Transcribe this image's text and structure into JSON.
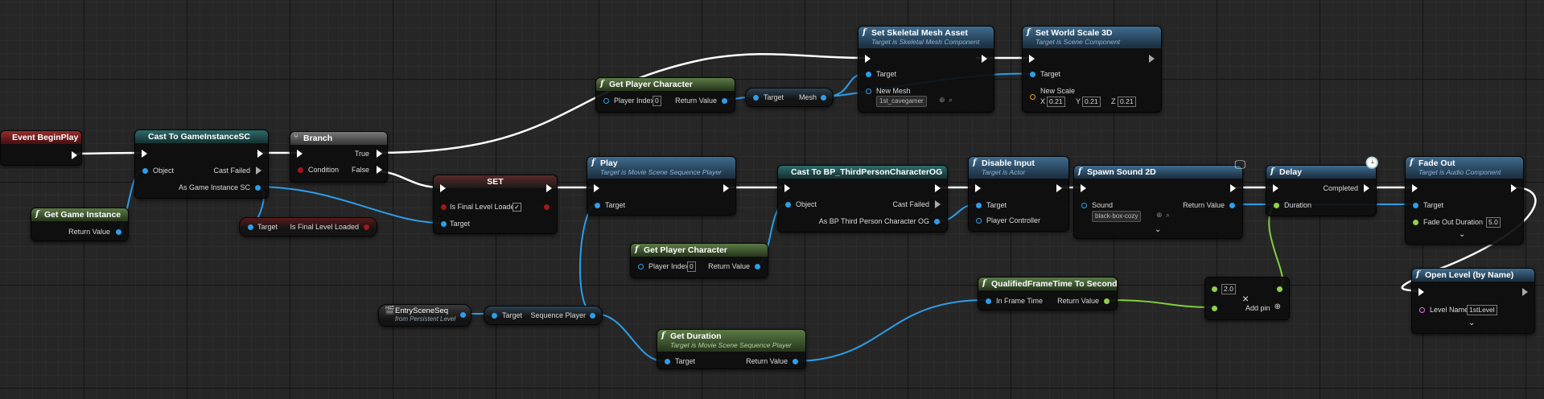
{
  "nodes": {
    "event_begin_play": {
      "title": "Event BeginPlay"
    },
    "get_game_instance": {
      "title": "Get Game Instance",
      "return_value": "Return Value"
    },
    "cast_gi": {
      "title": "Cast To GameInstanceSC",
      "object": "Object",
      "cast_failed": "Cast Failed",
      "as_gi": "As Game Instance SC"
    },
    "branch": {
      "title": "Branch",
      "condition": "Condition",
      "true": "True",
      "false": "False"
    },
    "is_final_get": {
      "target": "Target",
      "value": "Is Final Level Loaded"
    },
    "set_node": {
      "title": "SET",
      "var": "Is Final Level Loaded",
      "target": "Target",
      "checked": "✓"
    },
    "get_player_char_top": {
      "title": "Get Player Character",
      "player_index": "Player Index",
      "player_index_value": "0",
      "return_value": "Return Value"
    },
    "mesh_get": {
      "target": "Target",
      "mesh": "Mesh"
    },
    "set_skel": {
      "title": "Set Skeletal Mesh Asset",
      "subtitle": "Target is Skeletal Mesh Component",
      "target": "Target",
      "new_mesh": "New Mesh",
      "mesh_value": "1st_cavegamer"
    },
    "set_scale": {
      "title": "Set World Scale 3D",
      "subtitle": "Target is Scene Component",
      "target": "Target",
      "new_scale": "New Scale",
      "x_label": "X",
      "x": "0.21",
      "y_label": "Y",
      "y": "0.21",
      "z_label": "Z",
      "z": "0.21"
    },
    "play": {
      "title": "Play",
      "subtitle": "Target is Movie Scene Sequence Player",
      "target": "Target"
    },
    "cast_bp": {
      "title": "Cast To BP_ThirdPersonCharacterOG",
      "object": "Object",
      "cast_failed": "Cast Failed",
      "as_bp": "As BP Third Person Character OG"
    },
    "disable_input": {
      "title": "Disable Input",
      "subtitle": "Target is Actor",
      "target": "Target",
      "player_controller": "Player Controller"
    },
    "spawn_sound": {
      "title": "Spawn Sound 2D",
      "sound": "Sound",
      "sound_value": "black-box-cozy",
      "return_value": "Return Value"
    },
    "delay": {
      "title": "Delay",
      "completed": "Completed",
      "duration": "Duration"
    },
    "fade_out": {
      "title": "Fade Out",
      "subtitle": "Target is Audio Component",
      "target": "Target",
      "fade_duration": "Fade Out Duration",
      "fade_value": "5.0"
    },
    "get_player_char_mid": {
      "title": "Get Player Character",
      "player_index": "Player Index",
      "player_index_value": "0",
      "return_value": "Return Value"
    },
    "qft": {
      "title": "QualifiedFrameTime To Seconds",
      "in_frame": "In Frame Time",
      "return_value": "Return Value"
    },
    "multiply": {
      "value": "2.0",
      "add_pin": "Add pin",
      "op": "×"
    },
    "open_level": {
      "title": "Open Level (by Name)",
      "level_name": "Level Name",
      "level_value": "1stLevel"
    },
    "entry_scene": {
      "title": "EntrySceneSeq",
      "subtitle": "from Persistent Level"
    },
    "seq_player": {
      "target": "Target",
      "seq": "Sequence Player"
    },
    "get_duration": {
      "title": "Get Duration",
      "subtitle": "Target is Movie Scene Sequence Player",
      "target": "Target",
      "return_value": "Return Value"
    }
  }
}
